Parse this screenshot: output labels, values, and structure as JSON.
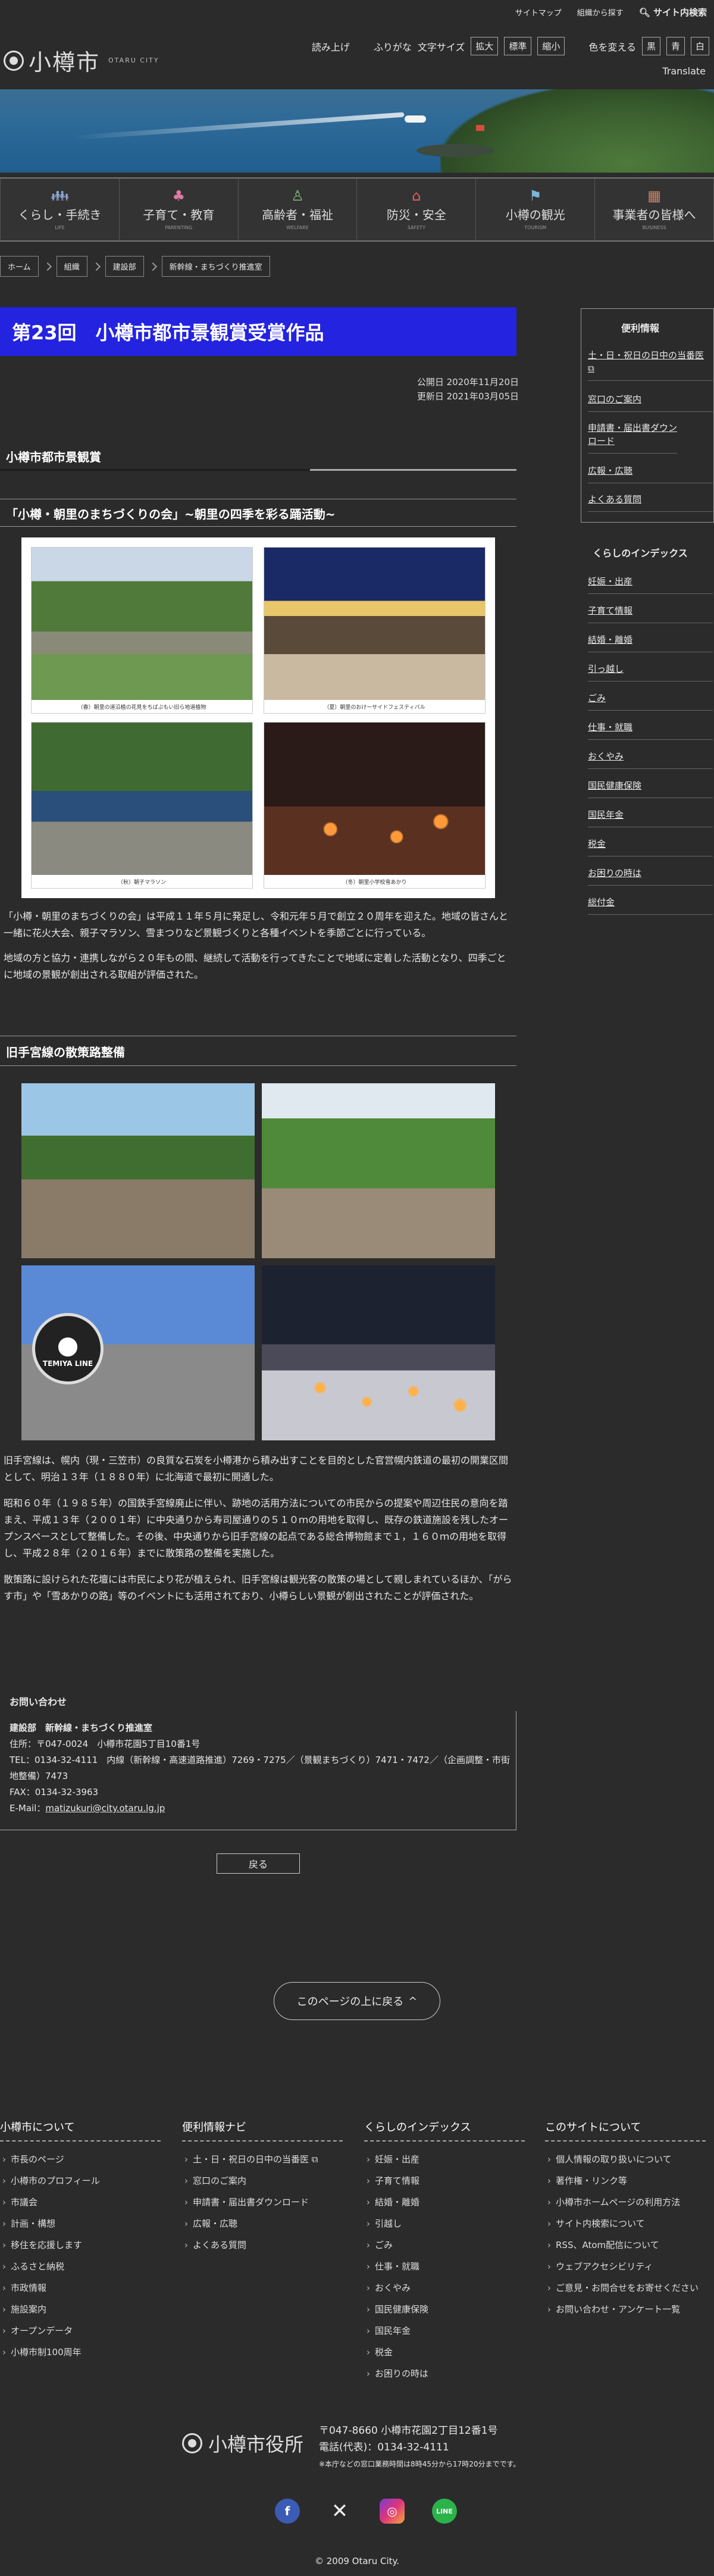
{
  "header": {
    "links": [
      "サイトマップ",
      "組織から探す",
      "サイト内検索"
    ],
    "logo_text": "小樽市",
    "logo_en": "OTARU CITY",
    "tools": {
      "read_aloud": "読み上げ",
      "furigana": "ふりがな",
      "font_size_label": "文字サイズ",
      "font_buttons": [
        "拡大",
        "標準",
        "縮小"
      ],
      "color_label": "色を変える",
      "color_buttons": [
        "黒",
        "青",
        "白"
      ],
      "translate": "Translate"
    }
  },
  "categories": [
    {
      "label": "くらし・手続き",
      "sub": "LIFE",
      "icon": "person-icon",
      "color": "#8fa8d8"
    },
    {
      "label": "子育て・教育",
      "sub": "PARENTING",
      "icon": "stroller-icon",
      "color": "#e07aa0"
    },
    {
      "label": "高齢者・福祉",
      "sub": "WELFARE",
      "icon": "walking-person-icon",
      "color": "#7cc07a"
    },
    {
      "label": "防災・安全",
      "sub": "SAFETY",
      "icon": "house-icon",
      "color": "#e06060"
    },
    {
      "label": "小樽の観光",
      "sub": "TOURISM",
      "icon": "flag-icon",
      "color": "#7ab8d8"
    },
    {
      "label": "事業者の皆様へ",
      "sub": "BUSINESS",
      "icon": "building-icon",
      "color": "#c88868"
    }
  ],
  "breadcrumbs": [
    "ホーム",
    "組織",
    "建設部",
    "新幹線・まちづくり推進室"
  ],
  "page": {
    "title": "第23回　小樽市都市景観賞受賞作品",
    "published": "公開日 2020年11月20日",
    "updated": "更新日 2021年03月05日"
  },
  "section1": {
    "heading": "小樽市都市景観賞",
    "subheading": "「小樽・朝里のまちづくりの会」~朝里の四季を彩る踊活動~",
    "captions": [
      "（春）朝里の道沿植の花見をちばぶもい旧ら地道植物",
      "（夏）朝里のおけーサイドフェスティバル",
      "（秋）朝子マラソン",
      "（冬）朝里小学校雪あかり"
    ],
    "para1": "「小樽・朝里のまちづくりの会」は平成１１年５月に発足し、令和元年５月で創立２０周年を迎えた。地域の皆さんと一緒に花火大会、親子マラソン、雪まつりなど景観づくりと各種イベントを季節ごとに行っている。",
    "para2": "地域の方と協力・連携しながら２０年もの間、継続して活動を行ってきたことで地域に定着した活動となり、四季ごとに地域の景観が創出される取組が評価された。"
  },
  "section2": {
    "subheading": "旧手宮線の散策路整備",
    "para1": "旧手宮線は、幌内（現・三笠市）の良質な石炭を小樽港から積み出すことを目的とした官営幌内鉄道の最初の開業区間として、明治１３年（１８８０年）に北海道で最初に開通した。",
    "para2": "昭和６０年（１９８５年）の国鉄手宮線廃止に伴い、跡地の活用方法についての市民からの提案や周辺住民の意向を踏まえ、平成１３年（２００１年）に中央通りから寿司屋通りの５１０ｍの用地を取得し、既存の鉄道施設を残したオープンスペースとして整備した。その後、中央通りから旧手宮線の起点である総合博物館まで１，１６０ｍの用地を取得し、平成２８年（２０１６年）までに散策路の整備を実施した。",
    "para3": "散策路に設けられた花壇には市民により花が植えられ、旧手宮線は観光客の散策の場として親しまれているほか、「がらす市」や「雪あかりの路」等のイベントにも活用されており、小樽らしい景観が創出されたことが評価された。",
    "sign_text": "TEMIYA LINE"
  },
  "contact": {
    "heading": "お問い合わせ",
    "dept": "建設部　新幹線・まちづくり推進室",
    "address": "住所：〒047-0024　小樽市花園5丁目10番1号",
    "tel": "TEL：0134-32-4111　内線（新幹線・高速道路推進）7269・7275／（景観まちづくり）7471・7472／（企画調整・市街地整備）7473",
    "fax": "FAX：0134-32-3963",
    "mail_label": "E-Mail：",
    "mail": "matizukuri@city.otaru.lg.jp"
  },
  "back_label": "戻る",
  "totop_label": "このページの上に戻る",
  "sidebar": {
    "convenience_heading": "便利情報",
    "convenience_items": [
      "土・日・祝日の日中の当番医",
      "窓口のご案内",
      "申請書・届出書ダウンロード",
      "広報・広聴",
      "よくある質問"
    ],
    "index_heading": "くらしのインデックス",
    "index_items": [
      "妊娠・出産",
      "子育て情報",
      "結婚・離婚",
      "引っ越し",
      "ごみ",
      "仕事・就職",
      "おくやみ",
      "国民健康保険",
      "国民年金",
      "税金",
      "お困りの時は",
      "総付金"
    ]
  },
  "footer": {
    "col1": {
      "heading": "小樽市について",
      "items": [
        "市長のページ",
        "小樽市のプロフィール",
        "市議会",
        "計画・構想",
        "移住を応援します",
        "ふるさと納税",
        "市政情報",
        "施設案内",
        "オープンデータ",
        "小樽市制100周年"
      ]
    },
    "col2": {
      "heading": "便利情報ナビ",
      "items": [
        "土・日・祝日の日中の当番医",
        "窓口のご案内",
        "申請書・届出書ダウンロード",
        "広報・広聴",
        "よくある質問"
      ]
    },
    "col3": {
      "heading": "くらしのインデックス",
      "items": [
        "妊娠・出産",
        "子育て情報",
        "結婚・離婚",
        "引越し",
        "ごみ",
        "仕事・就職",
        "おくやみ",
        "国民健康保険",
        "国民年金",
        "税金",
        "お困りの時は"
      ]
    },
    "col4": {
      "heading": "このサイトについて",
      "items": [
        "個人情報の取り扱いについて",
        "著作権・リンク等",
        "小樽市ホームページの利用方法",
        "サイト内検索について",
        "RSS、Atom配信について",
        "ウェブアクセシビリティ",
        "ご意見・お問合せをお寄せください",
        "お問い合わせ・アンケート一覧"
      ]
    },
    "logo_text": "小樽市役所",
    "address": "〒047-8660 小樽市花園2丁目12番1号",
    "tel": "電話(代表)：0134-32-4111",
    "hours": "※本庁などの窓口業務時間は8時45分から17時20分までです。",
    "copyright": "© 2009 Otaru City."
  }
}
